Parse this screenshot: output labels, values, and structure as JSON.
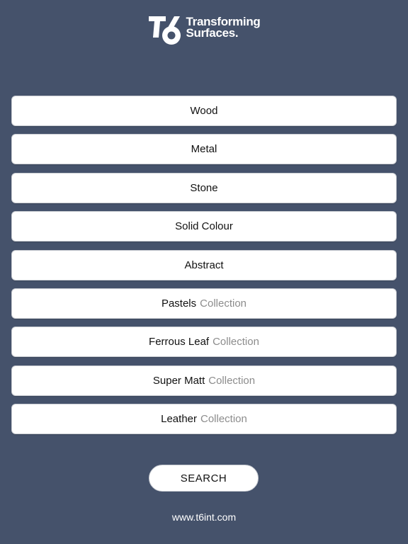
{
  "brand": {
    "line1": "Transforming",
    "line2": "Surfaces."
  },
  "menu": {
    "items": [
      {
        "label": "Wood",
        "sub": ""
      },
      {
        "label": "Metal",
        "sub": ""
      },
      {
        "label": "Stone",
        "sub": ""
      },
      {
        "label": "Solid Colour",
        "sub": ""
      },
      {
        "label": "Abstract",
        "sub": ""
      },
      {
        "label": "Pastels",
        "sub": "Collection"
      },
      {
        "label": "Ferrous Leaf",
        "sub": "Collection"
      },
      {
        "label": "Super Matt",
        "sub": "Collection"
      },
      {
        "label": "Leather",
        "sub": "Collection"
      }
    ]
  },
  "search": {
    "label": "SEARCH"
  },
  "footer": {
    "website": "www.t6int.com"
  },
  "colors": {
    "background": "#45526b",
    "button_bg": "#ffffff",
    "muted_text": "#8c8c8c"
  }
}
